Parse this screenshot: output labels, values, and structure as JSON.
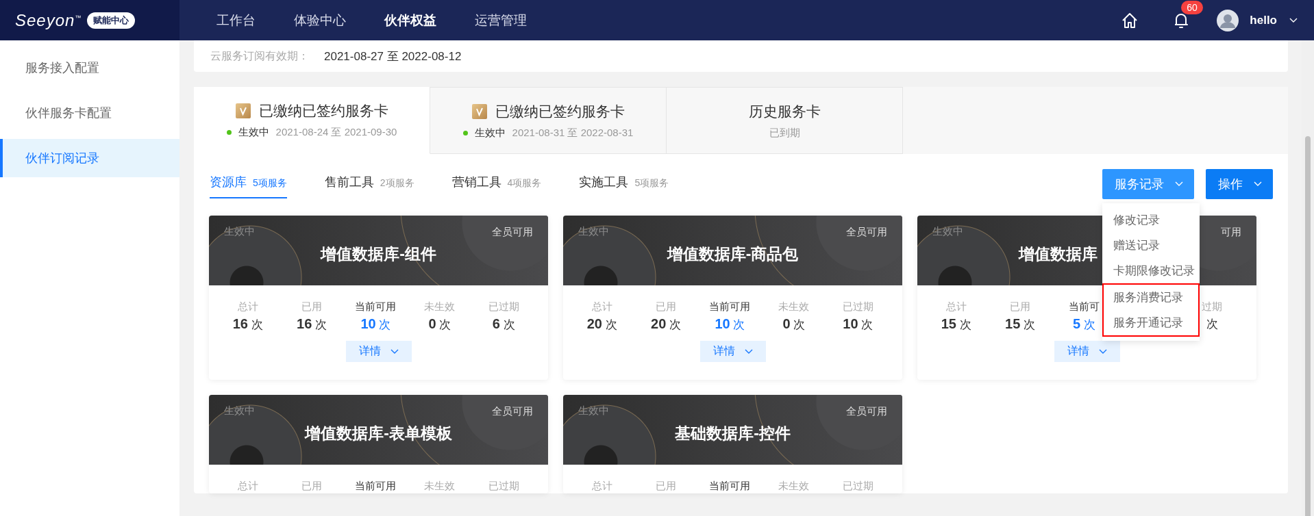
{
  "header": {
    "logo": "Seeyon",
    "logo_mark": "™",
    "logo_badge": "赋能中心",
    "nav": [
      {
        "label": "工作台",
        "selected": false
      },
      {
        "label": "体验中心",
        "selected": false
      },
      {
        "label": "伙伴权益",
        "selected": true
      },
      {
        "label": "运营管理",
        "selected": false
      }
    ],
    "notification_count": "60",
    "user": "hello"
  },
  "sidebar": {
    "items": [
      {
        "label": "服务接入配置",
        "selected": false
      },
      {
        "label": "伙伴服务卡配置",
        "selected": false
      },
      {
        "label": "伙伴订阅记录",
        "selected": true
      }
    ]
  },
  "subscription": {
    "label": "云服务订阅有效期：",
    "value": "2021-08-27 至 2022-08-12"
  },
  "card_tabs": [
    {
      "title": "已缴纳已签约服务卡",
      "kind": "active_card",
      "status": "生效中",
      "dates": "2021-08-24 至 2021-09-30",
      "selected": true
    },
    {
      "title": "已缴纳已签约服务卡",
      "kind": "active_card",
      "status": "生效中",
      "dates": "2021-08-31 至 2022-08-31",
      "selected": false
    },
    {
      "title": "历史服务卡",
      "kind": "history",
      "status": "已到期",
      "selected": false
    }
  ],
  "sub_tabs": [
    {
      "label": "资源库",
      "count": "5项服务",
      "selected": true
    },
    {
      "label": "售前工具",
      "count": "2项服务",
      "selected": false
    },
    {
      "label": "营销工具",
      "count": "4项服务",
      "selected": false
    },
    {
      "label": "实施工具",
      "count": "5项服务",
      "selected": false
    }
  ],
  "buttons": [
    {
      "label": "服务记录",
      "expanded": true
    },
    {
      "label": "操作",
      "expanded": false
    }
  ],
  "dropdown": [
    {
      "label": "修改记录",
      "highlighted": false
    },
    {
      "label": "赠送记录",
      "highlighted": false
    },
    {
      "label": "卡期限修改记录",
      "highlighted": false
    },
    {
      "label": "服务消费记录",
      "highlighted": true
    },
    {
      "label": "服务开通记录",
      "highlighted": true
    }
  ],
  "cards": [
    {
      "status": "生效中",
      "scope": "全员可用",
      "title": "增值数据库-组件",
      "partial": false,
      "details": "详情",
      "stats": [
        {
          "kind": "count",
          "label": "总计",
          "value": "16",
          "unit": "次",
          "highlight": false
        },
        {
          "kind": "count",
          "label": "已用",
          "value": "16",
          "unit": "次",
          "highlight": false
        },
        {
          "kind": "count",
          "label": "当前可用",
          "value": "10",
          "unit": "次",
          "highlight": true
        },
        {
          "kind": "count",
          "label": "未生效",
          "value": "0",
          "unit": "次",
          "highlight": false
        },
        {
          "kind": "count",
          "label": "已过期",
          "value": "6",
          "unit": "次",
          "highlight": false
        }
      ]
    },
    {
      "status": "生效中",
      "scope": "全员可用",
      "title": "增值数据库-商品包",
      "partial": false,
      "details": "详情",
      "stats": [
        {
          "kind": "count",
          "label": "总计",
          "value": "20",
          "unit": "次",
          "highlight": false
        },
        {
          "kind": "count",
          "label": "已用",
          "value": "20",
          "unit": "次",
          "highlight": false
        },
        {
          "kind": "count",
          "label": "当前可用",
          "value": "10",
          "unit": "次",
          "highlight": true
        },
        {
          "kind": "count",
          "label": "未生效",
          "value": "0",
          "unit": "次",
          "highlight": false
        },
        {
          "kind": "count",
          "label": "已过期",
          "value": "10",
          "unit": "次",
          "highlight": false
        }
      ]
    },
    {
      "status": "生效中",
      "scope": "可用",
      "title": "增值数据库",
      "partial": true,
      "details": "详情",
      "stats": [
        {
          "kind": "count",
          "label": "总计",
          "value": "15",
          "unit": "次",
          "highlight": false
        },
        {
          "kind": "count",
          "label": "已用",
          "value": "15",
          "unit": "次",
          "highlight": false
        },
        {
          "kind": "count",
          "label": "当前可",
          "value": "5",
          "unit": "次",
          "highlight": true
        },
        {
          "kind": "covered"
        },
        {
          "kind": "count",
          "label": "过期",
          "unit": "次",
          "highlight": false
        }
      ]
    },
    {
      "status": "生效中",
      "scope": "全员可用",
      "title": "增值数据库-表单模板",
      "partial": false,
      "stats": [
        {
          "kind": "count",
          "label": "总计",
          "highlight": false
        },
        {
          "kind": "count",
          "label": "已用",
          "highlight": false
        },
        {
          "kind": "count",
          "label": "当前可用",
          "highlight": true
        },
        {
          "kind": "count",
          "label": "未生效",
          "highlight": false
        },
        {
          "kind": "count",
          "label": "已过期",
          "highlight": false
        }
      ]
    },
    {
      "status": "生效中",
      "scope": "全员可用",
      "title": "基础数据库-控件",
      "partial": false,
      "stats": [
        {
          "kind": "count",
          "label": "总计",
          "highlight": false
        },
        {
          "kind": "count",
          "label": "已用",
          "highlight": false
        },
        {
          "kind": "count",
          "label": "当前可用",
          "highlight": true
        },
        {
          "kind": "count",
          "label": "未生效",
          "highlight": false
        },
        {
          "kind": "count",
          "label": "已过期",
          "highlight": false
        }
      ]
    }
  ]
}
